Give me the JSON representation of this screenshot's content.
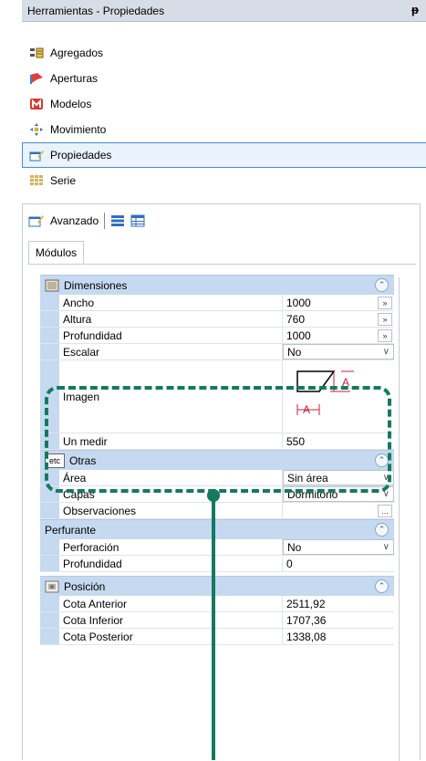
{
  "window": {
    "title": "Herramientas - Propiedades",
    "pin": "ᵽ"
  },
  "nav": {
    "items": [
      {
        "label": "Agregados"
      },
      {
        "label": "Aperturas"
      },
      {
        "label": "Modelos"
      },
      {
        "label": "Movimiento"
      },
      {
        "label": "Propiedades",
        "selected": true
      },
      {
        "label": "Serie"
      }
    ]
  },
  "toolbar": {
    "advanced_label": "Avanzado"
  },
  "tab": {
    "label": "Módulos"
  },
  "categories": {
    "dimensiones": "Dimensiones",
    "otras": "Otras",
    "otras_icon_text": "etc",
    "perfurante": "Perfurante",
    "posicion": "Posición"
  },
  "props": {
    "ancho": {
      "name": "Ancho",
      "value": "1000",
      "btn": "»"
    },
    "altura": {
      "name": "Altura",
      "value": "760",
      "btn": "»"
    },
    "profundidad": {
      "name": "Profundidad",
      "value": "1000",
      "btn": "»"
    },
    "escalar": {
      "name": "Escalar",
      "value": "No"
    },
    "imagen": {
      "name": "Imagen",
      "label_a1": "A",
      "label_a2": "A"
    },
    "un_medir": {
      "name": "Un medir",
      "value": "550"
    },
    "area": {
      "name": "Área",
      "value": "Sin área"
    },
    "capas": {
      "name": "Capas",
      "value": "Dormitorio"
    },
    "observaciones": {
      "name": "Observaciones",
      "value": "",
      "btn": "..."
    },
    "perforacion": {
      "name": "Perforación",
      "value": "No"
    },
    "profundidad2": {
      "name": "Profundidad",
      "value": "0"
    },
    "cota_anterior": {
      "name": "Cota Anterior",
      "value": "2511,92"
    },
    "cota_inferior": {
      "name": "Cota Inferior",
      "value": "1707,36"
    },
    "cota_posterior": {
      "name": "Cota Posterior",
      "value": "1338,08"
    }
  },
  "colors": {
    "accent": "#137a5e",
    "category": "#c5d9f0",
    "selection": "#4a8ad8"
  }
}
